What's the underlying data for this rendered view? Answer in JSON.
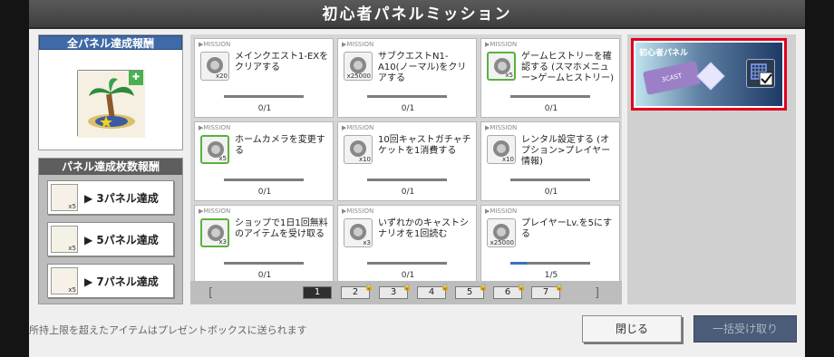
{
  "title": "初心者パネルミッション",
  "full_reward": {
    "header": "全パネル達成報酬",
    "icon": "palm-tree-emblem"
  },
  "count_rewards": {
    "header": "パネル達成枚数報酬",
    "items": [
      {
        "label": "▶ 3パネル達成",
        "qty": "x5"
      },
      {
        "label": "▶ 5パネル達成",
        "qty": "x5"
      },
      {
        "label": "▶ 7パネル達成",
        "qty": "x5"
      }
    ]
  },
  "missions": [
    {
      "tag": "▶MISSION",
      "qty": "x20",
      "text": "メインクエスト1-EXをクリアする",
      "progress": "0/1",
      "fraction": 0,
      "green": false
    },
    {
      "tag": "▶MISSION",
      "qty": "x25000",
      "text": "サブクエストN1-A10(ノーマル)をクリアする",
      "progress": "0/1",
      "fraction": 0,
      "green": false
    },
    {
      "tag": "▶MISSION",
      "qty": "x5",
      "text": "ゲームヒストリーを確認する (スマホメニュー>ゲームヒストリー)",
      "progress": "0/1",
      "fraction": 0,
      "green": true
    },
    {
      "tag": "▶MISSION",
      "qty": "x5",
      "text": "ホームカメラを変更する",
      "progress": "0/1",
      "fraction": 0,
      "green": true
    },
    {
      "tag": "▶MISSION",
      "qty": "x10",
      "text": "10回キャストガチャチケットを1消費する",
      "progress": "0/1",
      "fraction": 0,
      "green": false
    },
    {
      "tag": "▶MISSION",
      "qty": "x10",
      "text": "レンタル設定する (オプション>プレイヤー情報)",
      "progress": "0/1",
      "fraction": 0,
      "green": false
    },
    {
      "tag": "▶MISSION",
      "qty": "x3",
      "text": "ショップで1日1回無料のアイテムを受け取る",
      "progress": "0/1",
      "fraction": 0,
      "green": true
    },
    {
      "tag": "▶MISSION",
      "qty": "x3",
      "text": "いずれかのキャストシナリオを1回読む",
      "progress": "0/1",
      "fraction": 0,
      "green": false
    },
    {
      "tag": "▶MISSION",
      "qty": "x25000",
      "text": "プレイヤーLv.を5にする",
      "progress": "1/5",
      "fraction": 0.2,
      "green": false
    }
  ],
  "pager": {
    "pages": [
      "1",
      "2",
      "3",
      "4",
      "5",
      "6",
      "7"
    ],
    "active": "1"
  },
  "selected_panel": {
    "title": "初心者パネル",
    "ticket": "3CAST"
  },
  "footer": {
    "message": "所持上限を超えたアイテムはプレゼントボックスに送られます",
    "close": "閉じる",
    "claim_all": "一括受け取り"
  },
  "colors": {
    "accent": "#3f69a8",
    "progress": "#3b6fc1",
    "highlight": "#e0001c"
  }
}
